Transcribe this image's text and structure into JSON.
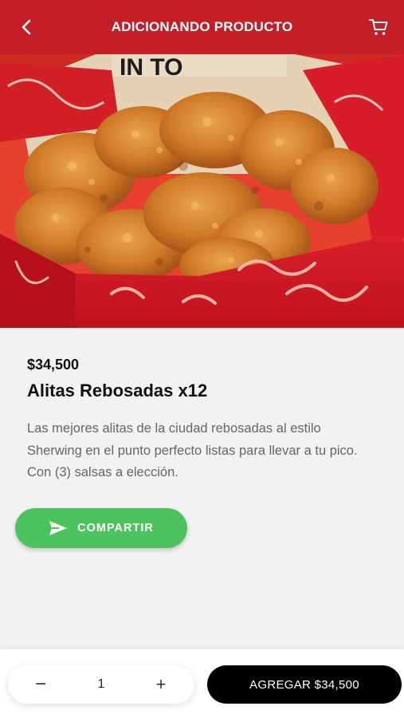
{
  "header": {
    "title": "ADICIONANDO PRODUCTO",
    "back_icon": "chevron-left-icon",
    "cart_icon": "shopping-cart-icon",
    "background_color": "#c41f27"
  },
  "product": {
    "image_alt": "fried-chicken-wings-in-red-box",
    "price": "$34,500",
    "name": "Alitas Rebosadas x12",
    "description": "Las mejores alitas de la ciudad rebosadas al estilo Sherwing en el punto perfecto listas para llevar a tu pico. Con (3) salsas a elección.",
    "box_print_text": "IN TO"
  },
  "share_button": {
    "label": "COMPARTIR",
    "icon": "send-icon",
    "color": "#4cc35e"
  },
  "cart_bar": {
    "minus_symbol": "−",
    "quantity": "1",
    "plus_symbol": "+",
    "add_label": "AGREGAR $34,500",
    "add_button_color": "#000000"
  }
}
